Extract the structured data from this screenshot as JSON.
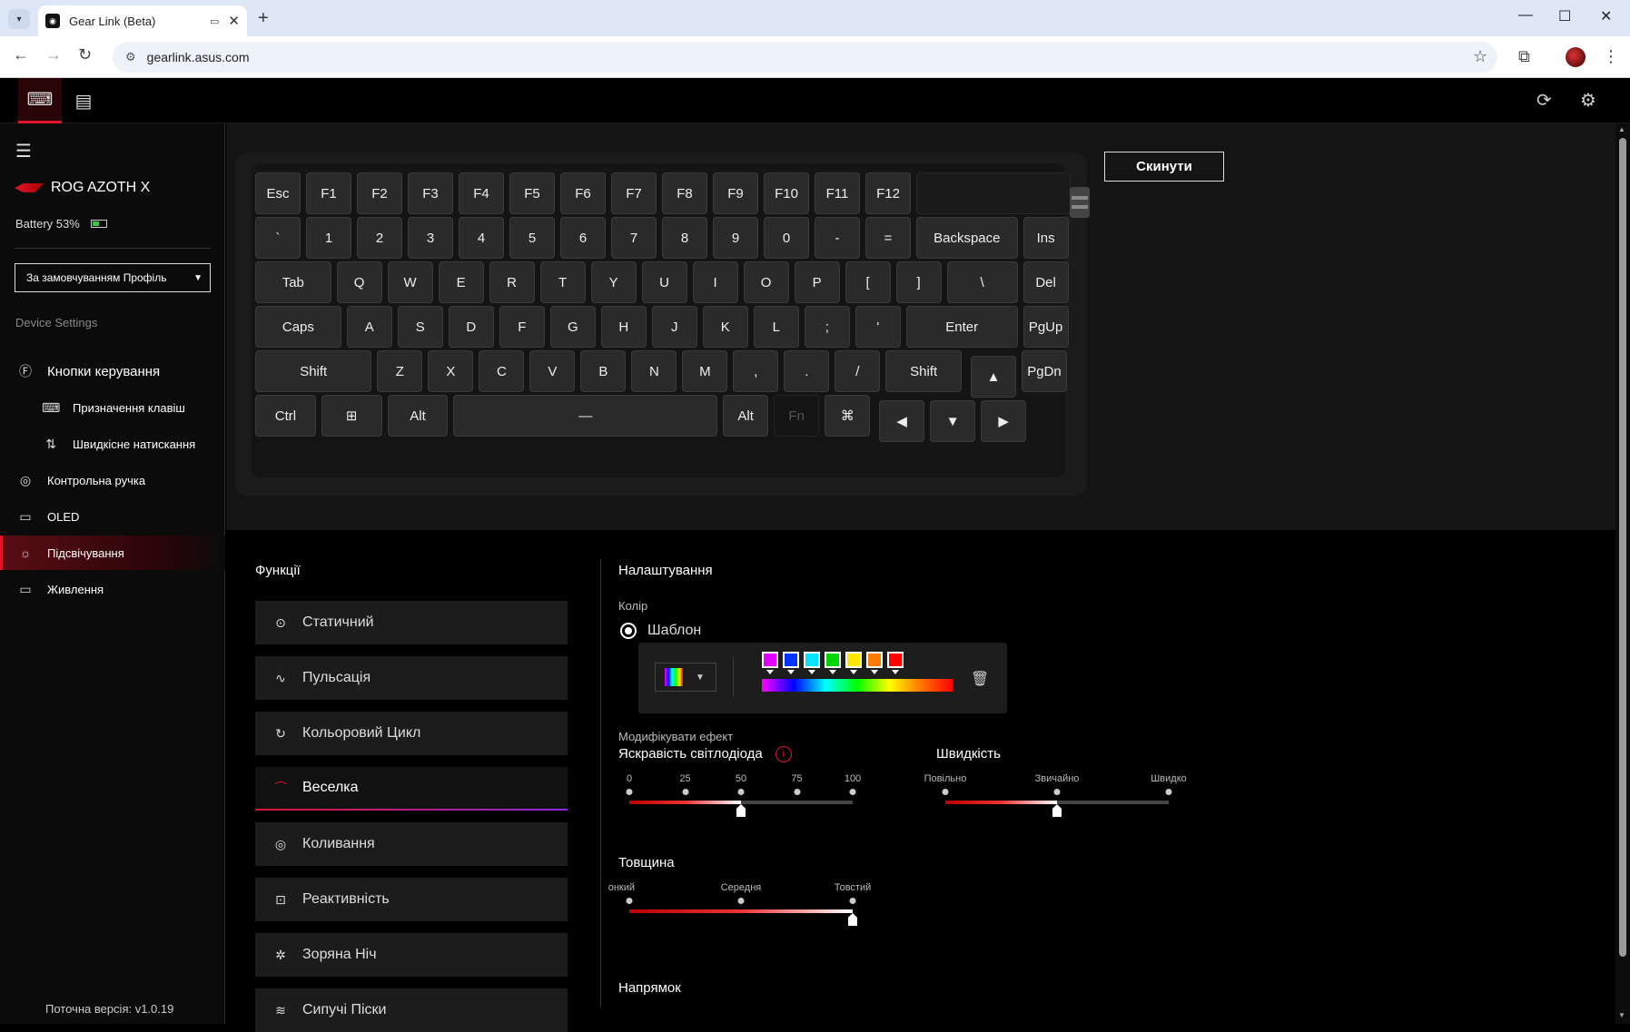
{
  "browser": {
    "tab_title": "Gear Link (Beta)",
    "url": "gearlink.asus.com",
    "new_tab": "+",
    "minimize": "—",
    "maximize": "☐",
    "close": "✕"
  },
  "app": {
    "device_name": "ROG AZOTH X",
    "battery_label": "Battery 53%",
    "battery_level": 0.53,
    "profile": "За замовчуванням Профіль",
    "section_title": "Device Settings",
    "nav": [
      {
        "label": "Кнопки керування",
        "icon": "fn-icon"
      },
      {
        "label": "Призначення клавіш",
        "icon": "keyboard-icon"
      },
      {
        "label": "Швидкісне натискання",
        "icon": "rapid-trigger-icon"
      },
      {
        "label": "Контрольна ручка",
        "icon": "knob-icon"
      },
      {
        "label": "OLED",
        "icon": "oled-icon"
      },
      {
        "label": "Підсвічування",
        "icon": "lighting-icon"
      },
      {
        "label": "Живлення",
        "icon": "power-icon"
      }
    ],
    "version": "Поточна версія: v1.0.19",
    "reset_label": "Скинути"
  },
  "keyboard": {
    "row0": [
      "Esc",
      "F1",
      "F2",
      "F3",
      "F4",
      "F5",
      "F6",
      "F7",
      "F8",
      "F9",
      "F10",
      "F11",
      "F12"
    ],
    "row1": [
      "`",
      "1",
      "2",
      "3",
      "4",
      "5",
      "6",
      "7",
      "8",
      "9",
      "0",
      "-",
      "=",
      "Backspace",
      "Ins"
    ],
    "row2": [
      "Tab",
      "Q",
      "W",
      "E",
      "R",
      "T",
      "Y",
      "U",
      "I",
      "O",
      "P",
      "[",
      "]",
      "\\",
      "Del"
    ],
    "row3": [
      "Caps",
      "A",
      "S",
      "D",
      "F",
      "G",
      "H",
      "J",
      "K",
      "L",
      ";",
      "'",
      "Enter",
      "PgUp"
    ],
    "row4": [
      "Shift",
      "Z",
      "X",
      "C",
      "V",
      "B",
      "N",
      "M",
      ",",
      ".",
      "/",
      "Shift",
      "▲",
      "PgDn"
    ],
    "row5": [
      "Ctrl",
      "⊞",
      "Alt",
      "—",
      "Alt",
      "Fn",
      "⌘",
      "◀",
      "▼",
      "▶"
    ]
  },
  "functions": {
    "title": "Функції",
    "items": [
      {
        "label": "Статичний",
        "icon": "static-icon"
      },
      {
        "label": "Пульсація",
        "icon": "pulse-icon"
      },
      {
        "label": "Кольоровий Цикл",
        "icon": "color-cycle-icon"
      },
      {
        "label": "Веселка",
        "icon": "rainbow-icon"
      },
      {
        "label": "Коливання",
        "icon": "wave-icon"
      },
      {
        "label": "Реактивність",
        "icon": "reactive-icon"
      },
      {
        "label": "Зоряна Ніч",
        "icon": "starry-night-icon"
      },
      {
        "label": "Сипучі Піски",
        "icon": "quicksand-icon"
      }
    ],
    "active_index": 3
  },
  "settings": {
    "title": "Налаштування",
    "color_label": "Колір",
    "template_label": "Шаблон",
    "swatches": [
      "#e100ff",
      "#0033ff",
      "#00e5ff",
      "#00d400",
      "#ffe600",
      "#ff7a00",
      "#ff0000"
    ],
    "modify_label": "Модифікувати ефект",
    "brightness": {
      "title": "Яскравість світлодіода",
      "ticks": [
        "0",
        "25",
        "50",
        "75",
        "100"
      ],
      "value": 50
    },
    "speed": {
      "title": "Швидкість",
      "ticks": [
        "Повільно",
        "Звичайно",
        "Швидко"
      ],
      "value_index": 1
    },
    "thickness": {
      "title": "Товщина",
      "ticks": [
        "онкий",
        "Середня",
        "Товстий"
      ],
      "value_index": 2
    },
    "direction_title": "Напрямок"
  }
}
